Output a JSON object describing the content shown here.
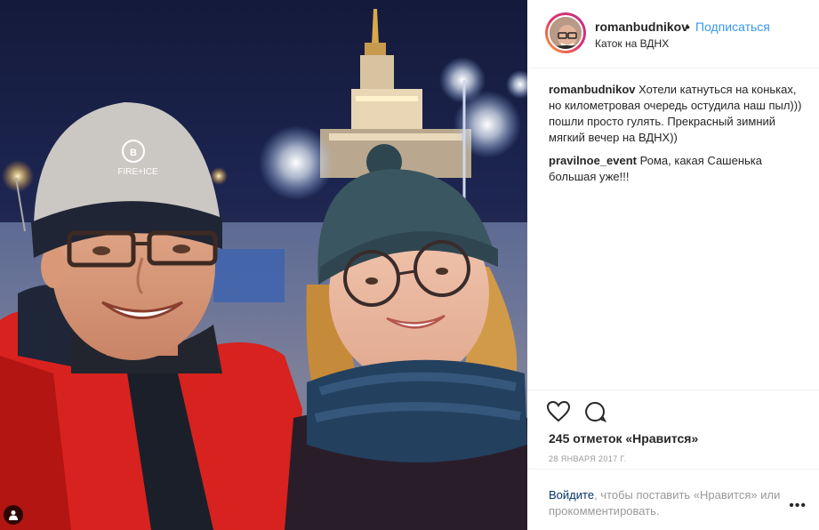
{
  "post": {
    "username": "romanbudnikov",
    "separator": "•",
    "follow_label": "Подписаться",
    "location": "Каток на ВДНХ"
  },
  "comments": [
    {
      "user": "romanbudnikov",
      "text": "Хотели катнуться на коньках, но километровая очередь остудила наш пыл))) пошли просто гулять. Прекрасный зимний мягкий вечер на ВДНХ))"
    },
    {
      "user": "pravilnoe_event",
      "text": "Рома, какая Сашенька большая уже!!!"
    }
  ],
  "actions": {
    "like_icon": "heart-icon",
    "comment_icon": "comment-icon"
  },
  "likes_text": "245 отметок «Нравится»",
  "date_text": "28 ЯНВАРЯ 2017 Г.",
  "login_prompt": {
    "link": "Войдите",
    "rest": ", чтобы поставить «Нравится» или прокомментировать."
  },
  "more_label": "•••",
  "photo": {
    "hat_logo_text": "FIRE+ICE"
  },
  "colors": {
    "link_blue": "#3897f0",
    "login_link": "#003569",
    "jacket_red": "#d8221f"
  }
}
